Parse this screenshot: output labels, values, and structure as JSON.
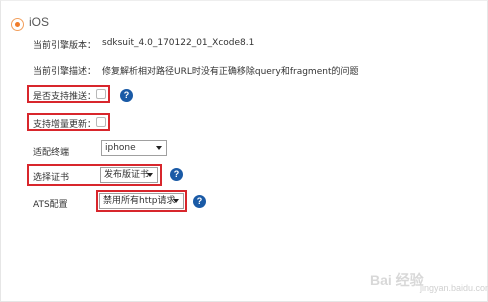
{
  "platform": {
    "label": "iOS",
    "selected": true
  },
  "fields": {
    "engine_version": {
      "label": "当前引擎版本：",
      "value": "sdksuit_4.0_170122_01_Xcode8.1"
    },
    "engine_description": {
      "label": "当前引擎描述：",
      "value": "修复解析相对路径URL时没有正确移除query和fragment的问题"
    },
    "push_support": {
      "label": "是否支持推送：",
      "checked": false,
      "help": "?"
    },
    "incremental_update": {
      "label": "支持增量更新：",
      "checked": false
    },
    "adapt_device": {
      "label": "适配终端",
      "value": "iphone"
    },
    "certificate": {
      "label": "选择证书",
      "value": "发布版证书",
      "help": "?"
    },
    "ats_config": {
      "label": "ATS配置",
      "value": "禁用所有http请求",
      "help": "?"
    }
  },
  "watermark": {
    "text": "Bai 经验",
    "sub": "jingyan.baidu.com"
  },
  "colors": {
    "highlight": "#d8262c",
    "help_icon": "#1a5aa6",
    "radio_accent": "#f07c2a"
  }
}
